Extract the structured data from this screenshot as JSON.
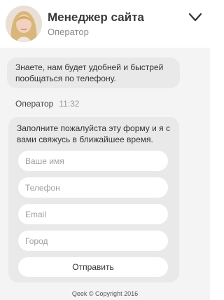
{
  "header": {
    "title": "Менеджер сайта",
    "subtitle": "Оператор",
    "collapse_icon": "chevron-down-icon"
  },
  "messages": {
    "intro": "Знаете, нам будет удобней и быстрей пообщаться по телефону.",
    "sender": "Оператор",
    "time": "11:32",
    "form_text": "Заполните пожалуйста эту форму и я с вами свяжусь в ближайшее время."
  },
  "form": {
    "name_placeholder": "Ваше имя",
    "phone_placeholder": "Телефон",
    "email_placeholder": "Email",
    "city_placeholder": "Город",
    "submit_label": "Отправить"
  },
  "footer": {
    "copyright": "Qeek © Copyright 2016"
  }
}
